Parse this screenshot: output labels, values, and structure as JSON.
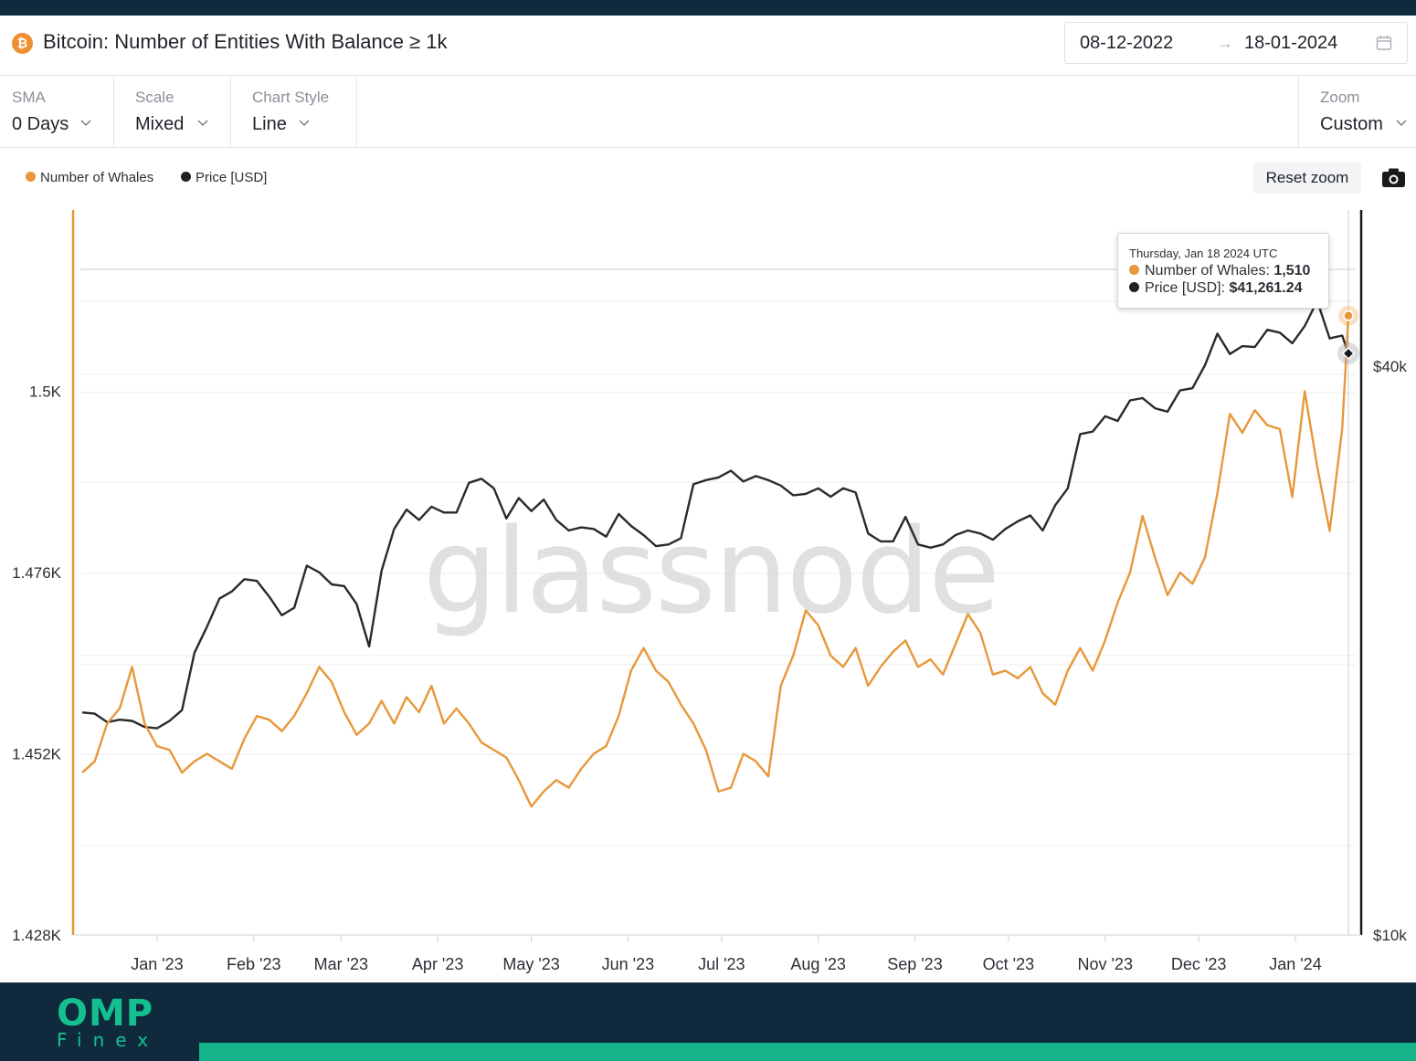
{
  "header": {
    "icon": "bitcoin-icon",
    "title": "Bitcoin: Number of Entities With Balance ≥ 1k",
    "date_start": "08-12-2022",
    "date_arrow": "→",
    "date_end": "18-01-2024"
  },
  "controls": {
    "sma_label": "SMA",
    "sma_value": "0 Days",
    "scale_label": "Scale",
    "scale_value": "Mixed",
    "style_label": "Chart Style",
    "style_value": "Line",
    "zoom_label": "Zoom",
    "zoom_value": "Custom"
  },
  "legend": {
    "whales": "Number of Whales",
    "price": "Price [USD]"
  },
  "toolbar": {
    "reset_zoom": "Reset zoom",
    "camera_icon": "camera-icon"
  },
  "tooltip": {
    "date": "Thursday, Jan 18 2024 UTC",
    "whales_label": "Number of Whales: ",
    "whales_value": "1,510",
    "price_label": "Price [USD]: ",
    "price_value": "$41,261.24"
  },
  "watermark": "glassnode",
  "footer": {
    "logo_main": "OMP",
    "logo_sub": "Finex"
  },
  "colors": {
    "whales": "#e8973a",
    "price": "#2a2a2a",
    "navy": "#0f2a3d",
    "teal": "#14b38a"
  },
  "chart_data": {
    "type": "line",
    "x_start": "2022-12-08",
    "x_end": "2024-01-18",
    "x_ticks": [
      "Jan '23",
      "Feb '23",
      "Mar '23",
      "Apr '23",
      "May '23",
      "Jun '23",
      "Jul '23",
      "Aug '23",
      "Sep '23",
      "Oct '23",
      "Nov '23",
      "Dec '23",
      "Jan '24"
    ],
    "y_left_ticks": [
      "1.428K",
      "1.452K",
      "1.476K",
      "1.5K"
    ],
    "y_left_range": [
      1428,
      1524
    ],
    "y_right_ticks": [
      "$10k",
      "$40k"
    ],
    "y_right_scale": "log",
    "series": [
      {
        "name": "Number of Whales",
        "axis": "left",
        "points": [
          [
            "2022-12-08",
            1449.5
          ],
          [
            "2022-12-12",
            1451.0
          ],
          [
            "2022-12-16",
            1456.0
          ],
          [
            "2022-12-20",
            1458.0
          ],
          [
            "2022-12-24",
            1463.5
          ],
          [
            "2022-12-28",
            1456.0
          ],
          [
            "2023-01-01",
            1453.0
          ],
          [
            "2023-01-05",
            1452.5
          ],
          [
            "2023-01-09",
            1449.5
          ],
          [
            "2023-01-13",
            1451.0
          ],
          [
            "2023-01-17",
            1452.0
          ],
          [
            "2023-01-21",
            1451.0
          ],
          [
            "2023-01-25",
            1450.0
          ],
          [
            "2023-01-29",
            1454.0
          ],
          [
            "2023-02-02",
            1457.0
          ],
          [
            "2023-02-06",
            1456.5
          ],
          [
            "2023-02-10",
            1455.0
          ],
          [
            "2023-02-14",
            1457.0
          ],
          [
            "2023-02-18",
            1460.0
          ],
          [
            "2023-02-22",
            1463.5
          ],
          [
            "2023-02-26",
            1461.5
          ],
          [
            "2023-03-02",
            1457.5
          ],
          [
            "2023-03-06",
            1454.5
          ],
          [
            "2023-03-10",
            1456.0
          ],
          [
            "2023-03-14",
            1459.0
          ],
          [
            "2023-03-18",
            1456.0
          ],
          [
            "2023-03-22",
            1459.5
          ],
          [
            "2023-03-26",
            1457.5
          ],
          [
            "2023-03-30",
            1461.0
          ],
          [
            "2023-04-03",
            1456.0
          ],
          [
            "2023-04-07",
            1458.0
          ],
          [
            "2023-04-11",
            1456.0
          ],
          [
            "2023-04-15",
            1453.5
          ],
          [
            "2023-04-19",
            1452.5
          ],
          [
            "2023-04-23",
            1451.5
          ],
          [
            "2023-04-27",
            1448.5
          ],
          [
            "2023-05-01",
            1445.0
          ],
          [
            "2023-05-05",
            1447.0
          ],
          [
            "2023-05-09",
            1448.5
          ],
          [
            "2023-05-13",
            1447.5
          ],
          [
            "2023-05-17",
            1450.0
          ],
          [
            "2023-05-21",
            1452.0
          ],
          [
            "2023-05-25",
            1453.0
          ],
          [
            "2023-05-29",
            1457.0
          ],
          [
            "2023-06-02",
            1463.0
          ],
          [
            "2023-06-06",
            1466.0
          ],
          [
            "2023-06-10",
            1463.0
          ],
          [
            "2023-06-14",
            1461.5
          ],
          [
            "2023-06-18",
            1458.5
          ],
          [
            "2023-06-22",
            1456.0
          ],
          [
            "2023-06-26",
            1452.5
          ],
          [
            "2023-06-30",
            1447.0
          ],
          [
            "2023-07-04",
            1447.5
          ],
          [
            "2023-07-08",
            1452.0
          ],
          [
            "2023-07-12",
            1451.0
          ],
          [
            "2023-07-16",
            1449.0
          ],
          [
            "2023-07-20",
            1461.0
          ],
          [
            "2023-07-24",
            1465.0
          ],
          [
            "2023-07-28",
            1471.0
          ],
          [
            "2023-08-01",
            1469.0
          ],
          [
            "2023-08-05",
            1465.0
          ],
          [
            "2023-08-09",
            1463.5
          ],
          [
            "2023-08-13",
            1466.0
          ],
          [
            "2023-08-17",
            1461.0
          ],
          [
            "2023-08-21",
            1463.5
          ],
          [
            "2023-08-25",
            1465.5
          ],
          [
            "2023-08-29",
            1467.0
          ],
          [
            "2023-09-02",
            1463.5
          ],
          [
            "2023-09-06",
            1464.5
          ],
          [
            "2023-09-10",
            1462.5
          ],
          [
            "2023-09-14",
            1466.5
          ],
          [
            "2023-09-18",
            1470.5
          ],
          [
            "2023-09-22",
            1468.0
          ],
          [
            "2023-09-26",
            1462.5
          ],
          [
            "2023-09-30",
            1463.0
          ],
          [
            "2023-10-04",
            1462.0
          ],
          [
            "2023-10-08",
            1463.5
          ],
          [
            "2023-10-12",
            1460.0
          ],
          [
            "2023-10-16",
            1458.5
          ],
          [
            "2023-10-20",
            1463.0
          ],
          [
            "2023-10-24",
            1466.0
          ],
          [
            "2023-10-28",
            1463.0
          ],
          [
            "2023-11-01",
            1467.0
          ],
          [
            "2023-11-05",
            1472.0
          ],
          [
            "2023-11-09",
            1476.0
          ],
          [
            "2023-11-13",
            1483.5
          ],
          [
            "2023-11-17",
            1478.0
          ],
          [
            "2023-11-21",
            1473.0
          ],
          [
            "2023-11-25",
            1476.0
          ],
          [
            "2023-11-29",
            1474.5
          ],
          [
            "2023-12-03",
            1478.0
          ],
          [
            "2023-12-07",
            1486.5
          ],
          [
            "2023-12-11",
            1497.0
          ],
          [
            "2023-12-15",
            1494.5
          ],
          [
            "2023-12-19",
            1497.5
          ],
          [
            "2023-12-23",
            1495.5
          ],
          [
            "2023-12-27",
            1495.0
          ],
          [
            "2023-12-31",
            1486.0
          ],
          [
            "2024-01-04",
            1500.0
          ],
          [
            "2024-01-08",
            1490.0
          ],
          [
            "2024-01-12",
            1481.5
          ],
          [
            "2024-01-16",
            1495.0
          ],
          [
            "2024-01-18",
            1510.0
          ]
        ]
      },
      {
        "name": "Price [USD]",
        "axis": "right",
        "points": [
          [
            "2022-12-08",
            17200
          ],
          [
            "2022-12-12",
            17150
          ],
          [
            "2022-12-16",
            16800
          ],
          [
            "2022-12-20",
            16900
          ],
          [
            "2022-12-24",
            16850
          ],
          [
            "2022-12-28",
            16600
          ],
          [
            "2023-01-01",
            16550
          ],
          [
            "2023-01-05",
            16850
          ],
          [
            "2023-01-09",
            17300
          ],
          [
            "2023-01-13",
            19900
          ],
          [
            "2023-01-17",
            21200
          ],
          [
            "2023-01-21",
            22700
          ],
          [
            "2023-01-25",
            23100
          ],
          [
            "2023-01-29",
            23800
          ],
          [
            "2023-02-02",
            23700
          ],
          [
            "2023-02-06",
            22800
          ],
          [
            "2023-02-10",
            21800
          ],
          [
            "2023-02-14",
            22200
          ],
          [
            "2023-02-18",
            24600
          ],
          [
            "2023-02-22",
            24200
          ],
          [
            "2023-02-26",
            23500
          ],
          [
            "2023-03-02",
            23400
          ],
          [
            "2023-03-06",
            22400
          ],
          [
            "2023-03-10",
            20200
          ],
          [
            "2023-03-14",
            24300
          ],
          [
            "2023-03-18",
            26900
          ],
          [
            "2023-03-22",
            28200
          ],
          [
            "2023-03-26",
            27500
          ],
          [
            "2023-03-30",
            28400
          ],
          [
            "2023-04-03",
            28000
          ],
          [
            "2023-04-07",
            28000
          ],
          [
            "2023-04-11",
            30100
          ],
          [
            "2023-04-15",
            30400
          ],
          [
            "2023-04-19",
            29700
          ],
          [
            "2023-04-23",
            27600
          ],
          [
            "2023-04-27",
            29000
          ],
          [
            "2023-05-01",
            28100
          ],
          [
            "2023-05-05",
            28900
          ],
          [
            "2023-05-09",
            27500
          ],
          [
            "2023-05-13",
            26800
          ],
          [
            "2023-05-17",
            27000
          ],
          [
            "2023-05-21",
            26900
          ],
          [
            "2023-05-25",
            26400
          ],
          [
            "2023-05-29",
            27900
          ],
          [
            "2023-06-02",
            27100
          ],
          [
            "2023-06-06",
            26500
          ],
          [
            "2023-06-10",
            25800
          ],
          [
            "2023-06-14",
            25900
          ],
          [
            "2023-06-18",
            26300
          ],
          [
            "2023-06-22",
            30000
          ],
          [
            "2023-06-26",
            30300
          ],
          [
            "2023-06-30",
            30500
          ],
          [
            "2023-07-04",
            31000
          ],
          [
            "2023-07-08",
            30200
          ],
          [
            "2023-07-12",
            30600
          ],
          [
            "2023-07-16",
            30300
          ],
          [
            "2023-07-20",
            29900
          ],
          [
            "2023-07-24",
            29200
          ],
          [
            "2023-07-28",
            29300
          ],
          [
            "2023-08-01",
            29700
          ],
          [
            "2023-08-05",
            29100
          ],
          [
            "2023-08-09",
            29700
          ],
          [
            "2023-08-13",
            29400
          ],
          [
            "2023-08-17",
            26600
          ],
          [
            "2023-08-21",
            26100
          ],
          [
            "2023-08-25",
            26100
          ],
          [
            "2023-08-29",
            27700
          ],
          [
            "2023-09-02",
            25900
          ],
          [
            "2023-09-06",
            25700
          ],
          [
            "2023-09-10",
            25900
          ],
          [
            "2023-09-14",
            26500
          ],
          [
            "2023-09-18",
            26800
          ],
          [
            "2023-09-22",
            26600
          ],
          [
            "2023-09-26",
            26200
          ],
          [
            "2023-09-30",
            26900
          ],
          [
            "2023-10-04",
            27400
          ],
          [
            "2023-10-08",
            27800
          ],
          [
            "2023-10-12",
            26800
          ],
          [
            "2023-10-16",
            28500
          ],
          [
            "2023-10-20",
            29700
          ],
          [
            "2023-10-24",
            33900
          ],
          [
            "2023-10-28",
            34100
          ],
          [
            "2023-11-01",
            35400
          ],
          [
            "2023-11-05",
            35000
          ],
          [
            "2023-11-09",
            36800
          ],
          [
            "2023-11-13",
            37000
          ],
          [
            "2023-11-17",
            36100
          ],
          [
            "2023-11-21",
            35800
          ],
          [
            "2023-11-25",
            37700
          ],
          [
            "2023-11-29",
            37900
          ],
          [
            "2023-12-03",
            40100
          ],
          [
            "2023-12-07",
            43300
          ],
          [
            "2023-12-11",
            41200
          ],
          [
            "2023-12-15",
            42000
          ],
          [
            "2023-12-19",
            41900
          ],
          [
            "2023-12-23",
            43700
          ],
          [
            "2023-12-27",
            43400
          ],
          [
            "2023-12-31",
            42300
          ],
          [
            "2024-01-04",
            44100
          ],
          [
            "2024-01-08",
            46900
          ],
          [
            "2024-01-12",
            42800
          ],
          [
            "2024-01-16",
            43100
          ],
          [
            "2024-01-18",
            41261.24
          ]
        ]
      }
    ],
    "grid": true,
    "legend_position": "top-left"
  }
}
